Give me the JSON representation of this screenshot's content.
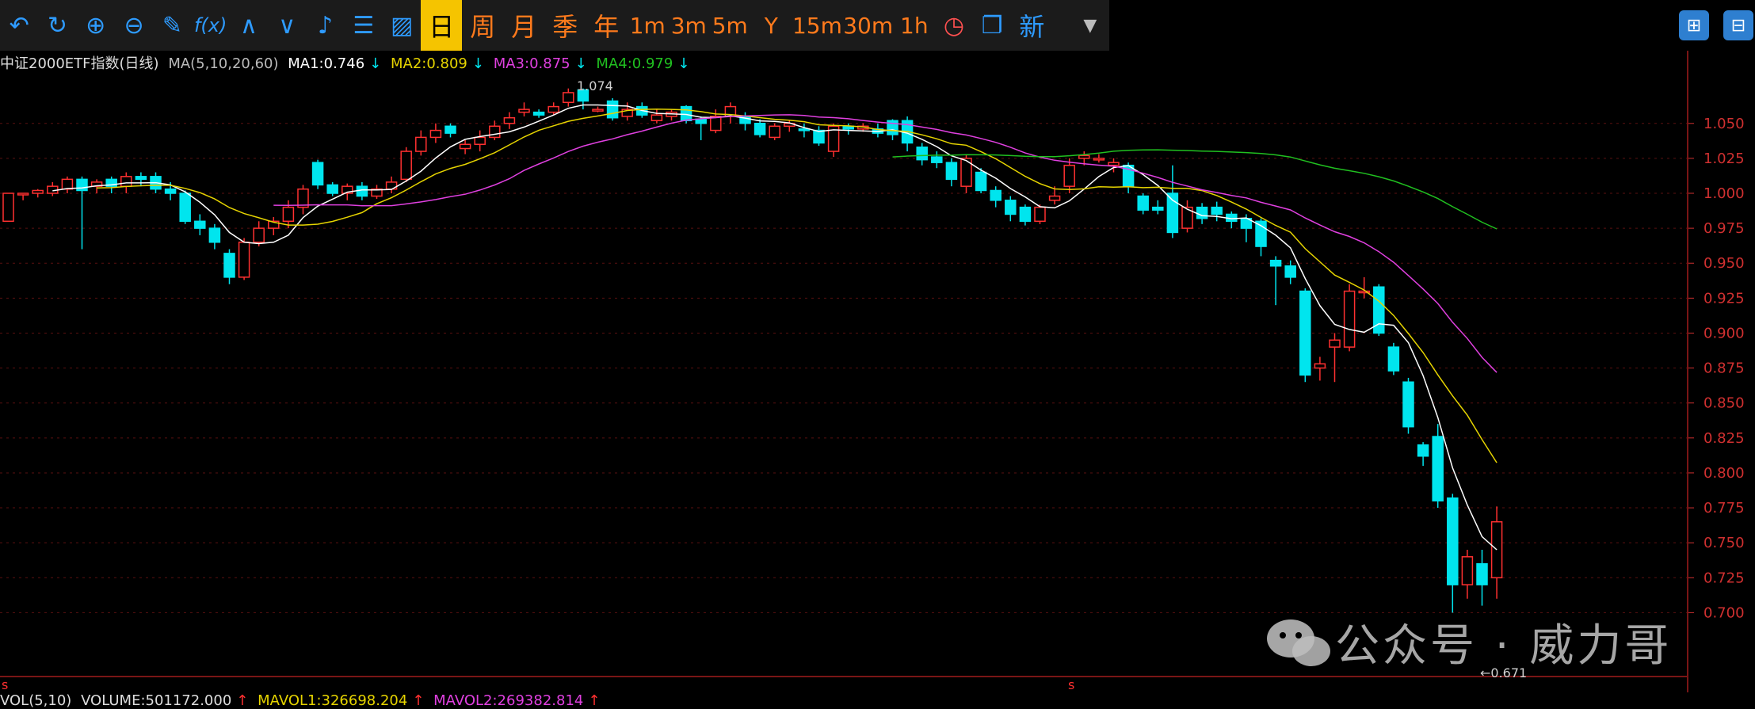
{
  "toolbar": {
    "icons": [
      "undo-icon",
      "refresh-icon",
      "zoom-in-icon",
      "zoom-out-icon",
      "draw-icon",
      "formula-icon",
      "up-icon",
      "down-icon",
      "alert-icon",
      "layout-icon",
      "chart-icon"
    ],
    "formula_label": "f(x)",
    "periods": [
      "日",
      "周",
      "月",
      "季",
      "年",
      "1m",
      "3m",
      "5m",
      "Y",
      "15m",
      "30m",
      "1h"
    ],
    "active_period": "日",
    "new_label": "新"
  },
  "legend": {
    "name": "中证2000ETF指数(日线)",
    "ma_params": "MA(5,10,20,60)",
    "ma1": "MA1:0.746",
    "ma2": "MA2:0.809",
    "ma3": "MA3:0.875",
    "ma4": "MA4:0.979"
  },
  "vol_legend": {
    "label": "VOL(5,10)",
    "volume": "VOLUME:501172.000",
    "mavol1": "MAVOL1:326698.204",
    "mavol2": "MAVOL2:269382.814"
  },
  "annotations": {
    "high": "1.074",
    "low": "←0.671",
    "flag": "s"
  },
  "watermark": {
    "text": "公众号 · 威力哥"
  },
  "colors": {
    "up": "#ff3030",
    "down": "#00e5ee",
    "ma1": "#ffffff",
    "ma2": "#e6d400",
    "ma3": "#e040e0",
    "ma4": "#20c020",
    "active": "#f5c400"
  },
  "chart_data": {
    "type": "candlestick",
    "ylim": [
      0.66,
      1.085
    ],
    "yticks": [
      "1.050",
      "1.025",
      "1.000",
      "0.975",
      "0.950",
      "0.925",
      "0.900",
      "0.875",
      "0.850",
      "0.825",
      "0.800",
      "0.775",
      "0.750",
      "0.725",
      "0.700"
    ],
    "candles": [
      [
        0.98,
        1.0,
        1.0,
        0.98
      ],
      [
        1.0,
        1.0,
        1.0,
        0.995
      ],
      [
        1.0,
        1.002,
        1.003,
        0.997
      ],
      [
        1.0,
        1.005,
        1.008,
        0.998
      ],
      [
        1.003,
        1.01,
        1.012,
        1.0
      ],
      [
        1.01,
        1.002,
        1.012,
        0.96
      ],
      [
        1.005,
        1.008,
        1.01,
        1.0
      ],
      [
        1.01,
        1.005,
        1.012,
        1.0
      ],
      [
        1.005,
        1.012,
        1.015,
        1.0
      ],
      [
        1.012,
        1.01,
        1.015,
        1.005
      ],
      [
        1.012,
        1.003,
        1.015,
        1.0
      ],
      [
        1.003,
        1.0,
        1.008,
        0.995
      ],
      [
        1.0,
        0.98,
        1.002,
        0.978
      ],
      [
        0.98,
        0.975,
        0.985,
        0.97
      ],
      [
        0.975,
        0.965,
        0.978,
        0.96
      ],
      [
        0.957,
        0.94,
        0.96,
        0.935
      ],
      [
        0.94,
        0.965,
        0.968,
        0.938
      ],
      [
        0.965,
        0.975,
        0.98,
        0.962
      ],
      [
        0.975,
        0.98,
        0.983,
        0.97
      ],
      [
        0.98,
        0.99,
        0.995,
        0.975
      ],
      [
        0.99,
        1.003,
        1.006,
        0.985
      ],
      [
        1.022,
        1.006,
        1.024,
        1.003
      ],
      [
        1.006,
        1.0,
        1.008,
        0.998
      ],
      [
        1.0,
        1.005,
        1.007,
        0.995
      ],
      [
        1.005,
        0.998,
        1.008,
        0.995
      ],
      [
        0.998,
        1.003,
        1.006,
        0.996
      ],
      [
        1.003,
        1.008,
        1.012,
        1.0
      ],
      [
        1.01,
        1.03,
        1.033,
        1.008
      ],
      [
        1.03,
        1.04,
        1.045,
        1.027
      ],
      [
        1.04,
        1.045,
        1.05,
        1.036
      ],
      [
        1.048,
        1.043,
        1.05,
        1.04
      ],
      [
        1.032,
        1.035,
        1.038,
        1.028
      ],
      [
        1.035,
        1.04,
        1.045,
        1.03
      ],
      [
        1.04,
        1.048,
        1.052,
        1.038
      ],
      [
        1.05,
        1.054,
        1.058,
        1.046
      ],
      [
        1.058,
        1.06,
        1.065,
        1.055
      ],
      [
        1.058,
        1.056,
        1.06,
        1.054
      ],
      [
        1.058,
        1.062,
        1.065,
        1.056
      ],
      [
        1.065,
        1.072,
        1.075,
        1.062
      ],
      [
        1.074,
        1.066,
        1.075,
        1.06
      ],
      [
        1.06,
        1.06,
        1.062,
        1.058
      ],
      [
        1.066,
        1.054,
        1.068,
        1.052
      ],
      [
        1.055,
        1.06,
        1.065,
        1.052
      ],
      [
        1.062,
        1.056,
        1.065,
        1.054
      ],
      [
        1.052,
        1.056,
        1.06,
        1.05
      ],
      [
        1.055,
        1.058,
        1.06,
        1.052
      ],
      [
        1.062,
        1.052,
        1.063,
        1.05
      ],
      [
        1.053,
        1.05,
        1.055,
        1.038
      ],
      [
        1.045,
        1.055,
        1.06,
        1.043
      ],
      [
        1.055,
        1.062,
        1.065,
        1.05
      ],
      [
        1.055,
        1.05,
        1.058,
        1.045
      ],
      [
        1.05,
        1.042,
        1.053,
        1.04
      ],
      [
        1.04,
        1.048,
        1.05,
        1.038
      ],
      [
        1.048,
        1.05,
        1.052,
        1.044
      ],
      [
        1.046,
        1.045,
        1.05,
        1.04
      ],
      [
        1.045,
        1.036,
        1.048,
        1.034
      ],
      [
        1.03,
        1.048,
        1.05,
        1.026
      ],
      [
        1.048,
        1.046,
        1.05,
        1.042
      ],
      [
        1.046,
        1.048,
        1.05,
        1.044
      ],
      [
        1.046,
        1.043,
        1.05,
        1.04
      ],
      [
        1.052,
        1.042,
        1.053,
        1.038
      ],
      [
        1.052,
        1.036,
        1.055,
        1.03
      ],
      [
        1.033,
        1.024,
        1.036,
        1.02
      ],
      [
        1.026,
        1.022,
        1.03,
        1.018
      ],
      [
        1.022,
        1.01,
        1.025,
        1.005
      ],
      [
        1.005,
        1.025,
        1.028,
        1.0
      ],
      [
        1.015,
        1.002,
        1.018,
        1.0
      ],
      [
        1.002,
        0.995,
        1.005,
        0.99
      ],
      [
        0.995,
        0.985,
        0.998,
        0.98
      ],
      [
        0.99,
        0.98,
        0.992,
        0.977
      ],
      [
        0.98,
        0.99,
        0.992,
        0.978
      ],
      [
        0.995,
        0.998,
        1.005,
        0.992
      ],
      [
        1.005,
        1.02,
        1.025,
        1.0
      ],
      [
        1.025,
        1.027,
        1.03,
        1.02
      ],
      [
        1.025,
        1.025,
        1.028,
        1.022
      ],
      [
        1.02,
        1.022,
        1.025,
        1.015
      ],
      [
        1.02,
        1.005,
        1.022,
        1.0
      ],
      [
        0.998,
        0.988,
        1.0,
        0.985
      ],
      [
        0.99,
        0.988,
        0.995,
        0.985
      ],
      [
        1.0,
        0.972,
        1.02,
        0.968
      ],
      [
        0.975,
        0.99,
        0.995,
        0.972
      ],
      [
        0.99,
        0.982,
        0.993,
        0.978
      ],
      [
        0.99,
        0.985,
        0.994,
        0.98
      ],
      [
        0.985,
        0.98,
        0.987,
        0.975
      ],
      [
        0.982,
        0.975,
        0.985,
        0.965
      ],
      [
        0.98,
        0.962,
        0.982,
        0.955
      ],
      [
        0.952,
        0.948,
        0.955,
        0.92
      ],
      [
        0.948,
        0.94,
        0.952,
        0.935
      ],
      [
        0.93,
        0.87,
        0.932,
        0.865
      ],
      [
        0.875,
        0.878,
        0.883,
        0.866
      ],
      [
        0.89,
        0.895,
        0.9,
        0.865
      ],
      [
        0.89,
        0.93,
        0.935,
        0.887
      ],
      [
        0.93,
        0.93,
        0.94,
        0.925
      ],
      [
        0.933,
        0.9,
        0.935,
        0.898
      ],
      [
        0.89,
        0.873,
        0.893,
        0.87
      ],
      [
        0.865,
        0.833,
        0.868,
        0.828
      ],
      [
        0.82,
        0.812,
        0.822,
        0.805
      ],
      [
        0.826,
        0.78,
        0.835,
        0.775
      ],
      [
        0.782,
        0.72,
        0.785,
        0.7
      ],
      [
        0.72,
        0.74,
        0.745,
        0.71
      ],
      [
        0.735,
        0.72,
        0.745,
        0.705
      ],
      [
        0.725,
        0.765,
        0.776,
        0.71
      ]
    ]
  }
}
